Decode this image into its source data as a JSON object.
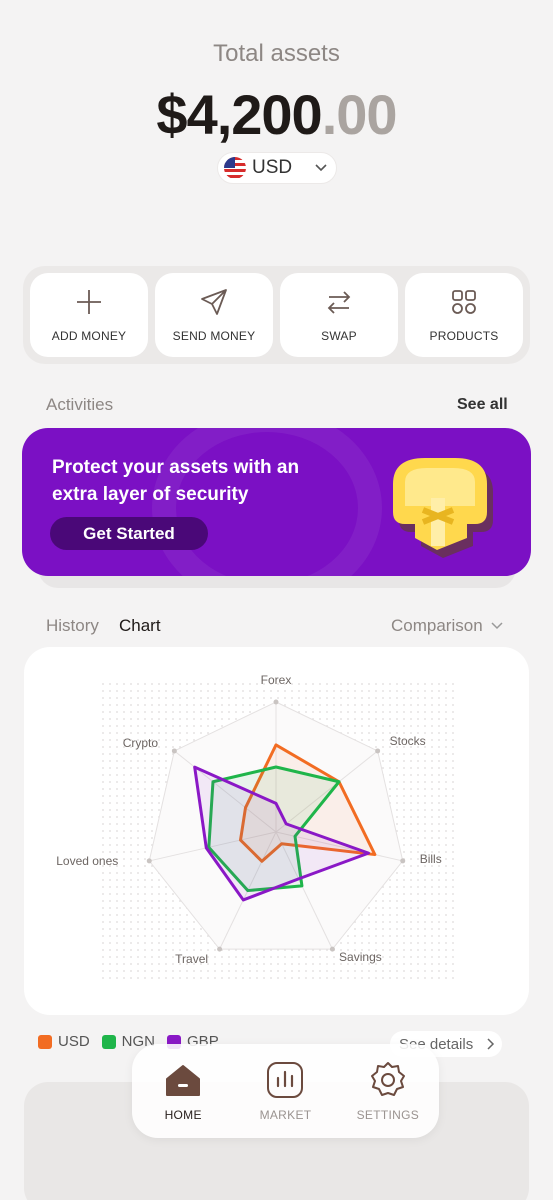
{
  "header": {
    "title": "Total assets",
    "balance_main": "$4,200",
    "balance_cents": ".00",
    "currency": "USD"
  },
  "actions": [
    {
      "label": "ADD MONEY",
      "icon": "plus-icon"
    },
    {
      "label": "SEND MONEY",
      "icon": "paper-plane-icon"
    },
    {
      "label": "SWAP",
      "icon": "swap-arrows-icon"
    },
    {
      "label": "PRODUCTS",
      "icon": "grid-icon"
    }
  ],
  "activities": {
    "title": "Activities",
    "see_all": "See all",
    "promo": {
      "text": "Protect your assets with an extra layer of security",
      "cta": "Get Started",
      "color": "#7b10c4"
    }
  },
  "chart_section": {
    "tab_history": "History",
    "tab_chart": "Chart",
    "filter": "Comparison",
    "see_details": "See details"
  },
  "chart_data": {
    "type": "radar",
    "axes": [
      "Forex",
      "Stocks",
      "Bills",
      "Savings",
      "Travel",
      "Loved ones",
      "Crypto"
    ],
    "scale_max": 1,
    "series": [
      {
        "name": "USD",
        "color": "#f26c22",
        "values": [
          0.67,
          0.62,
          0.78,
          0.1,
          0.25,
          0.28,
          0.3
        ]
      },
      {
        "name": "NGN",
        "color": "#1fb54a",
        "values": [
          0.5,
          0.62,
          0.15,
          0.46,
          0.5,
          0.53,
          0.62
        ]
      },
      {
        "name": "GBP",
        "color": "#8a18c6",
        "values": [
          0.22,
          0.1,
          0.73,
          0.4,
          0.58,
          0.55,
          0.8
        ]
      }
    ]
  },
  "nav": [
    {
      "label": "HOME",
      "icon": "home-icon",
      "active": true
    },
    {
      "label": "MARKET",
      "icon": "bar-chart-icon",
      "active": false
    },
    {
      "label": "SETTINGS",
      "icon": "gear-icon",
      "active": false
    }
  ]
}
